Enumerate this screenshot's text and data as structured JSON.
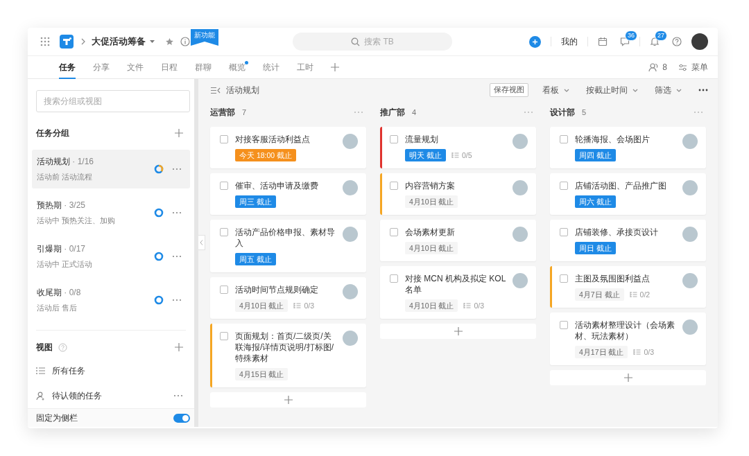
{
  "header": {
    "project_title": "大促活动筹备",
    "new_feature_badge": "新功能",
    "search_placeholder": "搜索 TB",
    "mine_label": "我的",
    "message_count": "36",
    "notification_count": "27"
  },
  "tabs": [
    {
      "label": "任务",
      "selected": true,
      "dot": false
    },
    {
      "label": "分享",
      "selected": false,
      "dot": false
    },
    {
      "label": "文件",
      "selected": false,
      "dot": false
    },
    {
      "label": "日程",
      "selected": false,
      "dot": false
    },
    {
      "label": "群聊",
      "selected": false,
      "dot": false
    },
    {
      "label": "概览",
      "selected": false,
      "dot": true
    },
    {
      "label": "统计",
      "selected": false,
      "dot": false
    },
    {
      "label": "工时",
      "selected": false,
      "dot": false
    }
  ],
  "member_count": "8",
  "menu_label": "菜单",
  "sidebar": {
    "search_placeholder": "搜索分组或视图",
    "groups_title": "任务分组",
    "groups": [
      {
        "name": "活动规划",
        "count": "· 1/16",
        "description": "活动前 活动流程",
        "selected": true,
        "level": 0.35
      },
      {
        "name": "预热期",
        "count": "· 3/25",
        "description": "活动中 预热关注、加购",
        "selected": false,
        "level": 0
      },
      {
        "name": "引爆期",
        "count": "· 0/17",
        "description": "活动中 正式活动",
        "selected": false,
        "level": 0
      },
      {
        "name": "收尾期",
        "count": "· 0/8",
        "description": "活动后 售后",
        "selected": false,
        "level": 0
      }
    ],
    "views_title": "视图",
    "views": [
      {
        "label": "所有任务",
        "kind": "list"
      },
      {
        "label": "待认领的任务",
        "kind": "claim"
      }
    ],
    "pin_label": "固定为侧栏",
    "pin_on": true
  },
  "board": {
    "breadcrumb": "活动规划",
    "save_view": "保存视图",
    "toolbar": [
      "看板",
      "按截止时间",
      "筛选"
    ],
    "columns": [
      {
        "name": "运营部",
        "count": "7",
        "cards": [
          {
            "title": "对接客服活动利益点",
            "checked": false,
            "due": {
              "text": "今天 18:00 截止",
              "kind": "today"
            }
          },
          {
            "title": "催审、活动申请及缴费",
            "checked": false,
            "due": {
              "text": "周三 截止",
              "kind": "soon"
            }
          },
          {
            "title": "活动产品价格申报、素材导入",
            "checked": false,
            "due": {
              "text": "周五 截止",
              "kind": "soon"
            }
          },
          {
            "title": "活动时间节点规则确定",
            "checked": false,
            "due": {
              "text": "4月10日 截止",
              "kind": "plain"
            },
            "subtasks": "0/3"
          },
          {
            "title": "页面规划：首页/二级页/关联海报/详情页说明/打标图/特殊素材",
            "checked": false,
            "due": {
              "text": "4月15日 截止",
              "kind": "plain"
            },
            "color": "#f5a623"
          }
        ]
      },
      {
        "name": "推广部",
        "count": "4",
        "cards": [
          {
            "title": "流量规划",
            "checked": false,
            "due": {
              "text": "明天 截止",
              "kind": "soon"
            },
            "subtasks": "0/5",
            "color": "#e0332f"
          },
          {
            "title": "内容营销方案",
            "checked": false,
            "due": {
              "text": "4月10日 截止",
              "kind": "plain"
            },
            "color": "#f5a623"
          },
          {
            "title": "会场素材更新",
            "checked": false,
            "due": {
              "text": "4月10日 截止",
              "kind": "plain"
            }
          },
          {
            "title": "对接 MCN 机构及拟定 KOL 名单",
            "checked": false,
            "due": {
              "text": "4月10日 截止",
              "kind": "plain"
            },
            "subtasks": "0/3"
          }
        ]
      },
      {
        "name": "设计部",
        "count": "5",
        "cards": [
          {
            "title": "轮播海报、会场图片",
            "checked": false,
            "due": {
              "text": "周四 截止",
              "kind": "soon"
            }
          },
          {
            "title": "店铺活动图、产品推广图",
            "checked": false,
            "due": {
              "text": "周六 截止",
              "kind": "soon"
            }
          },
          {
            "title": "店铺装修、承接页设计",
            "checked": false,
            "due": {
              "text": "周日 截止",
              "kind": "soon"
            }
          },
          {
            "title": "主图及氛围图利益点",
            "checked": false,
            "due": {
              "text": "4月7日 截止",
              "kind": "plain"
            },
            "subtasks": "0/2",
            "color": "#f5a623"
          },
          {
            "title": "活动素材整理设计（会场素材、玩法素材）",
            "checked": false,
            "due": {
              "text": "4月17日 截止",
              "kind": "plain"
            },
            "subtasks": "0/3"
          }
        ]
      }
    ]
  }
}
